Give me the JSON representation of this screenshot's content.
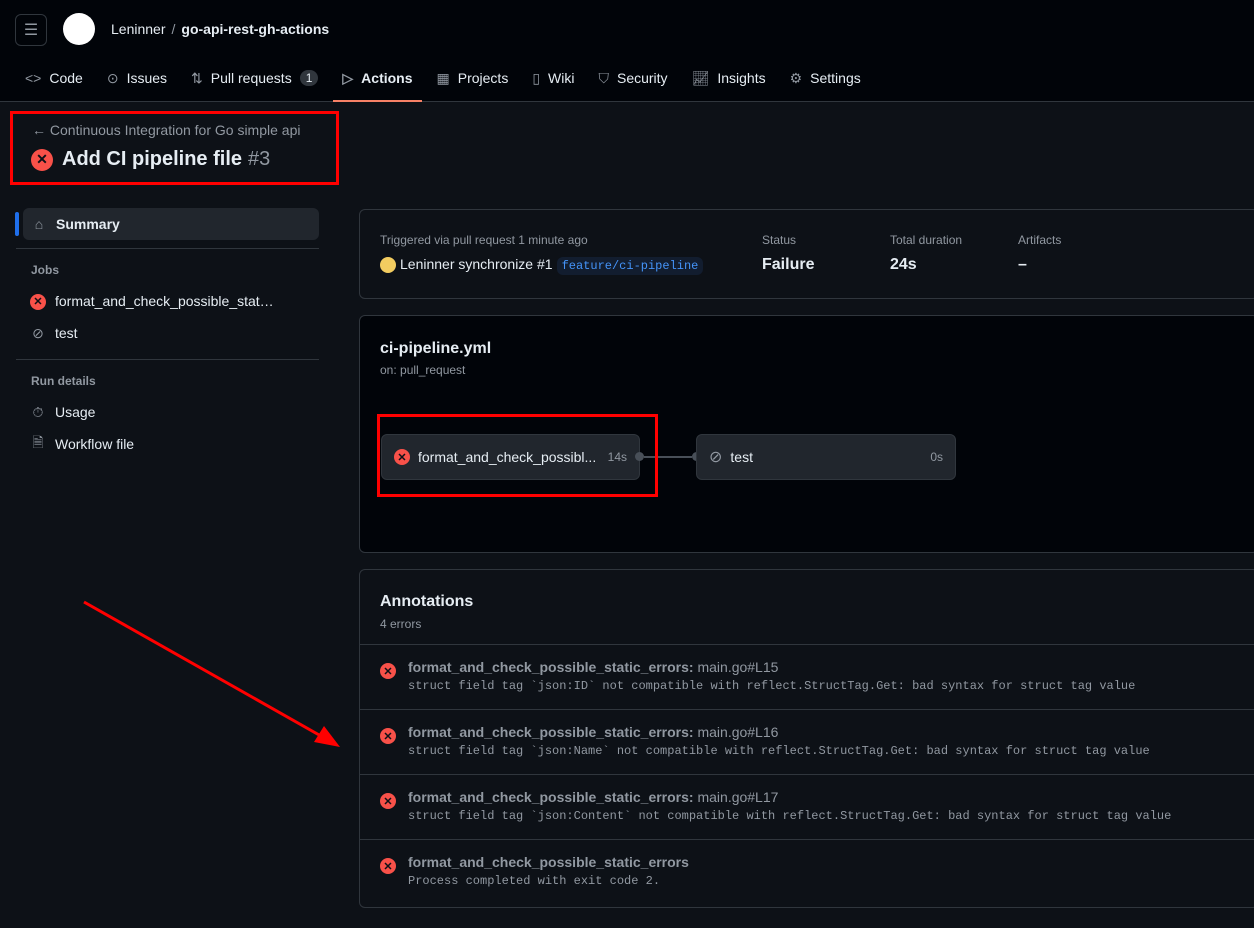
{
  "header": {
    "owner": "Leninner",
    "separator": "/",
    "repo": "go-api-rest-gh-actions"
  },
  "tabs": [
    {
      "label": "Code",
      "icon": "code-icon"
    },
    {
      "label": "Issues",
      "icon": "issue-icon"
    },
    {
      "label": "Pull requests",
      "icon": "pr-icon",
      "count": "1"
    },
    {
      "label": "Actions",
      "icon": "play-icon",
      "active": true
    },
    {
      "label": "Projects",
      "icon": "table-icon"
    },
    {
      "label": "Wiki",
      "icon": "book-icon"
    },
    {
      "label": "Security",
      "icon": "shield-icon"
    },
    {
      "label": "Insights",
      "icon": "graph-icon"
    },
    {
      "label": "Settings",
      "icon": "gear-icon"
    }
  ],
  "run": {
    "back_label": "Continuous Integration for Go simple api",
    "title": "Add CI pipeline file",
    "number": "#3"
  },
  "sidebar": {
    "summary": "Summary",
    "jobs_heading": "Jobs",
    "jobs": [
      "format_and_check_possible_stat…",
      "test"
    ],
    "details_heading": "Run details",
    "details": [
      "Usage",
      "Workflow file"
    ]
  },
  "summary": {
    "trigger": "Triggered via pull request 1 minute ago",
    "actor": "Leninner",
    "event": "synchronize #1",
    "branch": "feature/ci-pipeline",
    "status_label": "Status",
    "status": "Failure",
    "duration_label": "Total duration",
    "duration": "24s",
    "artifacts_label": "Artifacts",
    "artifacts": "–"
  },
  "workflow": {
    "file": "ci-pipeline.yml",
    "trigger": "on: pull_request",
    "jobs": [
      {
        "name": "format_and_check_possibl...",
        "duration": "14s"
      },
      {
        "name": "test",
        "duration": "0s"
      }
    ]
  },
  "annotations": {
    "title": "Annotations",
    "count": "4 errors",
    "items": [
      {
        "job": "format_and_check_possible_static_errors:",
        "loc": "main.go#L15",
        "msg": "struct field tag `json:ID` not compatible with reflect.StructTag.Get: bad syntax for struct tag value"
      },
      {
        "job": "format_and_check_possible_static_errors:",
        "loc": "main.go#L16",
        "msg": "struct field tag `json:Name` not compatible with reflect.StructTag.Get: bad syntax for struct tag value"
      },
      {
        "job": "format_and_check_possible_static_errors:",
        "loc": "main.go#L17",
        "msg": "struct field tag `json:Content` not compatible with reflect.StructTag.Get: bad syntax for struct tag value"
      },
      {
        "job": "format_and_check_possible_static_errors",
        "loc": "",
        "msg": "Process completed with exit code 2."
      }
    ]
  },
  "colors": {
    "error": "#f85149",
    "accent": "#1f6feb",
    "highlight": "#ff0000"
  }
}
